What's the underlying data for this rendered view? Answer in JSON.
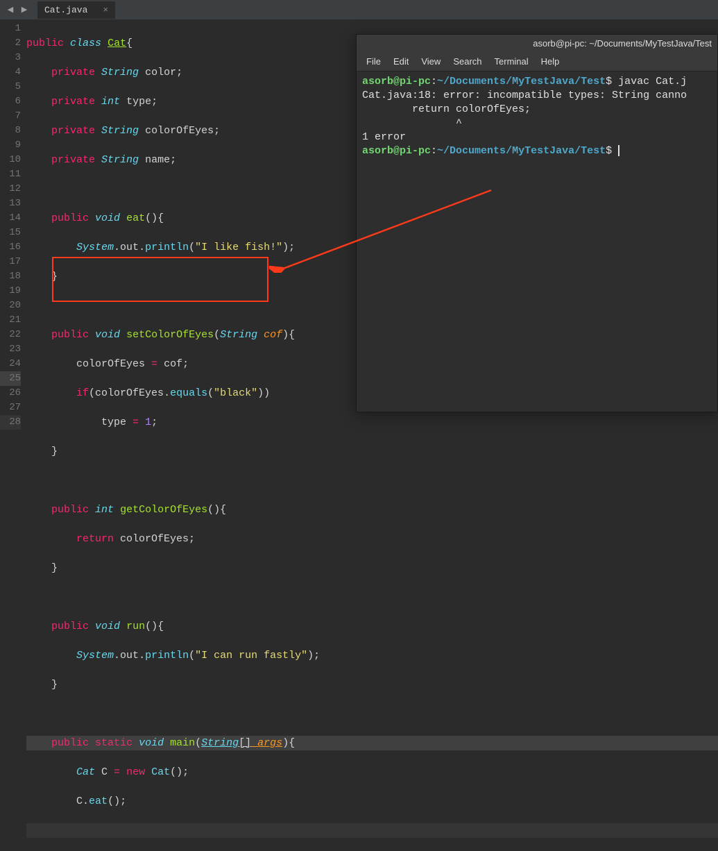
{
  "editor": {
    "tab": {
      "title": "Cat.java",
      "close_glyph": "×"
    },
    "nav": {
      "left": "◀",
      "right": "▶"
    },
    "line_numbers": [
      "1",
      "2",
      "3",
      "4",
      "5",
      "6",
      "7",
      "8",
      "9",
      "10",
      "11",
      "12",
      "13",
      "14",
      "15",
      "16",
      "17",
      "18",
      "19",
      "20",
      "21",
      "22",
      "23",
      "24",
      "25",
      "26",
      "27",
      "28"
    ],
    "code": {
      "l1": {
        "kw1": "public",
        "kw2": "class",
        "cls": "Cat",
        "brace": "{"
      },
      "l2": {
        "kw1": "private",
        "type": "String",
        "id": "color",
        ";": ";"
      },
      "l3": {
        "kw1": "private",
        "type": "int",
        "id": "type",
        ";": ";"
      },
      "l4": {
        "kw1": "private",
        "type": "String",
        "id": "colorOfEyes",
        ";": ";"
      },
      "l5": {
        "kw1": "private",
        "type": "String",
        "id": "name",
        ";": ";"
      },
      "l7": {
        "kw1": "public",
        "type": "void",
        "fn": "eat",
        "paren": "(){"
      },
      "l8": {
        "obj": "System",
        "dot1": ".",
        "out": "out",
        "dot2": ".",
        "fn": "println",
        "lp": "(",
        "str": "\"I like fish!\"",
        "rp": ");"
      },
      "l9": {
        "brace": "}"
      },
      "l11": {
        "kw1": "public",
        "type": "void",
        "fn": "setColorOfEyes",
        "lp": "(",
        "ptype": "String",
        "param": "cof",
        "rp": "){"
      },
      "l12": {
        "id": "colorOfEyes",
        "op": " = ",
        "param": "cof",
        ";": ";"
      },
      "l13": {
        "kw": "if",
        "lp": "(",
        "id": "colorOfEyes",
        "dot": ".",
        "fn": "equals",
        "lp2": "(",
        "str": "\"black\"",
        "rp": "))"
      },
      "l14": {
        "id": "type",
        "op": " = ",
        "num": "1",
        ";": ";"
      },
      "l15": {
        "brace": "}"
      },
      "l17": {
        "kw1": "public",
        "type": "int",
        "fn": "getColorOfEyes",
        "paren": "(){"
      },
      "l18": {
        "kw": "return",
        "id": " colorOfEyes;"
      },
      "l19": {
        "brace": "}"
      },
      "l21": {
        "kw1": "public",
        "type": "void",
        "fn": "run",
        "paren": "(){"
      },
      "l22": {
        "obj": "System",
        "dot1": ".",
        "out": "out",
        "dot2": ".",
        "fn": "println",
        "lp": "(",
        "str": "\"I can run fastly\"",
        "rp": ");"
      },
      "l23": {
        "brace": "}"
      },
      "l25": {
        "kw1": "public",
        "kw2": "static",
        "type": "void",
        "fn": "main",
        "lp": "(",
        "ptype": "String",
        "brk": "[]",
        "param": " args",
        "rp": "){"
      },
      "l26": {
        "type": "Cat",
        "id": " C",
        "op": " = ",
        "kw": "new",
        "sp": " ",
        "ctor": "Cat",
        "rp": "();"
      },
      "l27": {
        "id": "C",
        "dot": ".",
        "fn": "eat",
        "rp": "();"
      }
    }
  },
  "terminal": {
    "title": "asorb@pi-pc: ~/Documents/MyTestJava/Test",
    "menus": [
      "File",
      "Edit",
      "View",
      "Search",
      "Terminal",
      "Help"
    ],
    "lines": {
      "p1_user": "asorb@pi-pc",
      "p1_colon": ":",
      "p1_path": "~/Documents/MyTestJava/Test",
      "p1_dollar": "$ ",
      "p1_cmd": "javac Cat.j",
      "err1": "Cat.java:18: error: incompatible types: String canno",
      "err2": "        return colorOfEyes;",
      "err3": "               ^",
      "err4": "1 error",
      "p2_user": "asorb@pi-pc",
      "p2_colon": ":",
      "p2_path": "~/Documents/MyTestJava/Test",
      "p2_dollar": "$ "
    }
  }
}
